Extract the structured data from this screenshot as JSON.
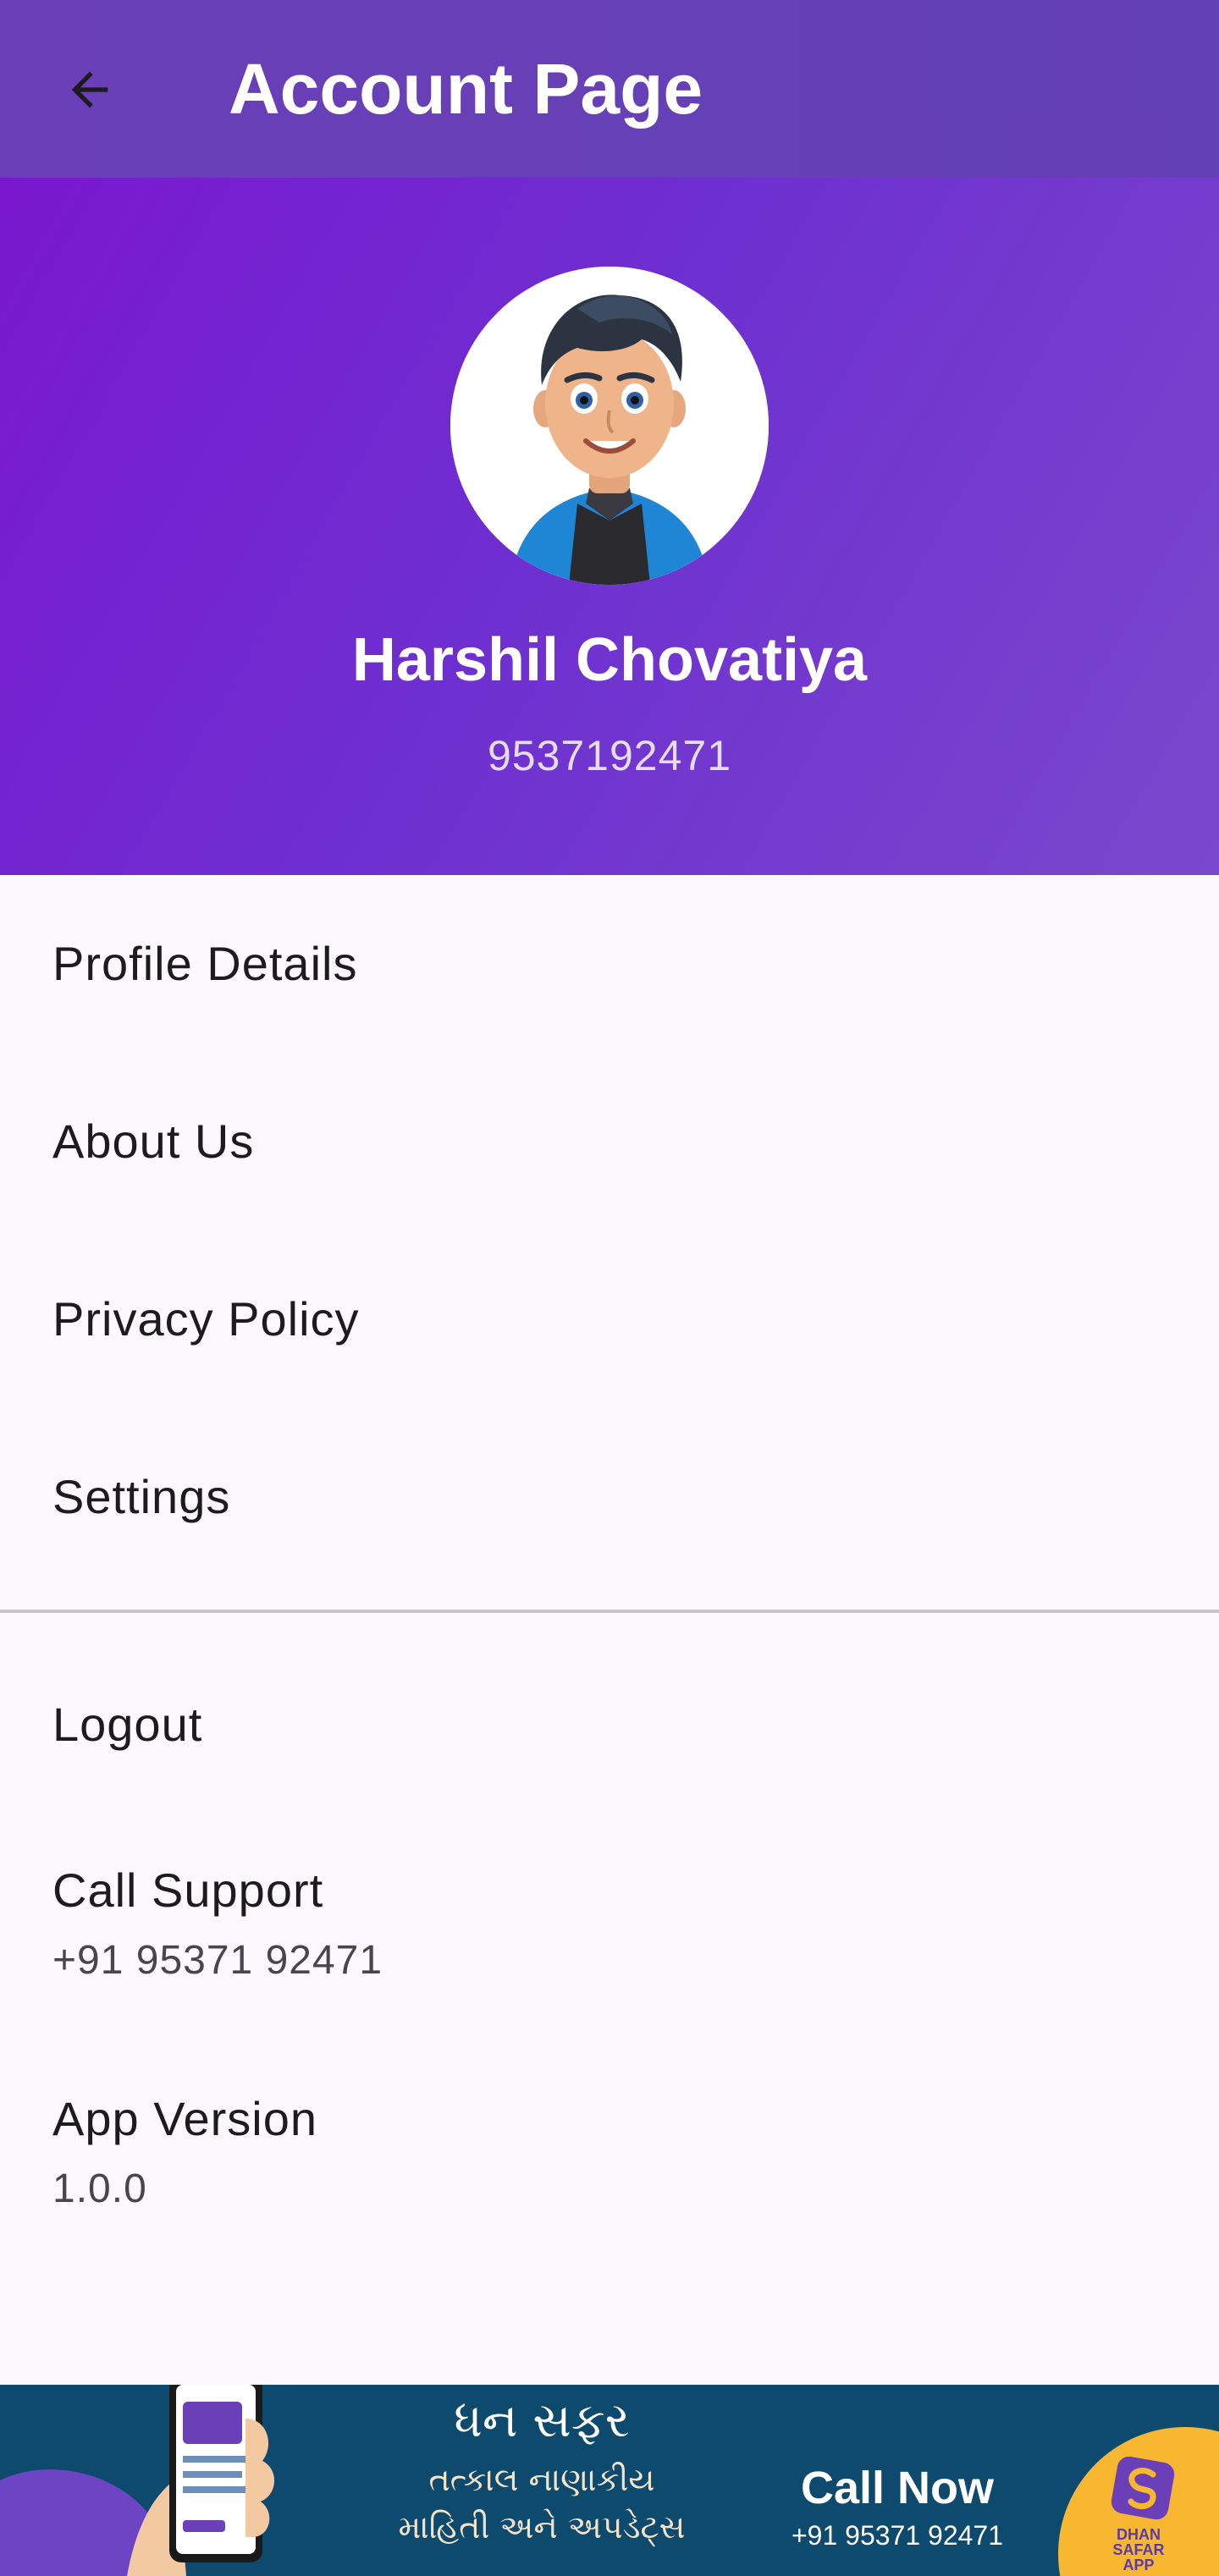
{
  "app_bar": {
    "title": "Account Page",
    "back_icon": "arrow-back-icon"
  },
  "profile": {
    "name": "Harshil Chovatiya",
    "phone": "9537192471",
    "avatar_icon": "cartoon-avatar"
  },
  "menu": {
    "items": [
      {
        "label": "Profile Details"
      },
      {
        "label": "About Us"
      },
      {
        "label": "Privacy Policy"
      },
      {
        "label": "Settings"
      }
    ],
    "logout": {
      "label": "Logout"
    },
    "call_support": {
      "label": "Call Support",
      "value": "+91 95371 92471"
    },
    "app_version": {
      "label": "App Version",
      "value": "1.0.0"
    }
  },
  "banner": {
    "title_gujarati": "ધન સફર",
    "subtitle_line1": "તત્કાલ નાણાકીય",
    "subtitle_line2": "માહિતી અને અપડેટ્સ",
    "cta": "Call Now",
    "phone": "+91 95371 92471",
    "logo_text_1": "DHAN",
    "logo_text_2": "SAFAR",
    "logo_text_3": "APP"
  },
  "colors": {
    "app_bar": "#6a3fb8",
    "header_gradient_start": "#7a18cf",
    "header_gradient_end": "#7a48cc",
    "background": "#fdf7fe",
    "banner": "#0e4a6e",
    "banner_accent": "#f7b731"
  }
}
